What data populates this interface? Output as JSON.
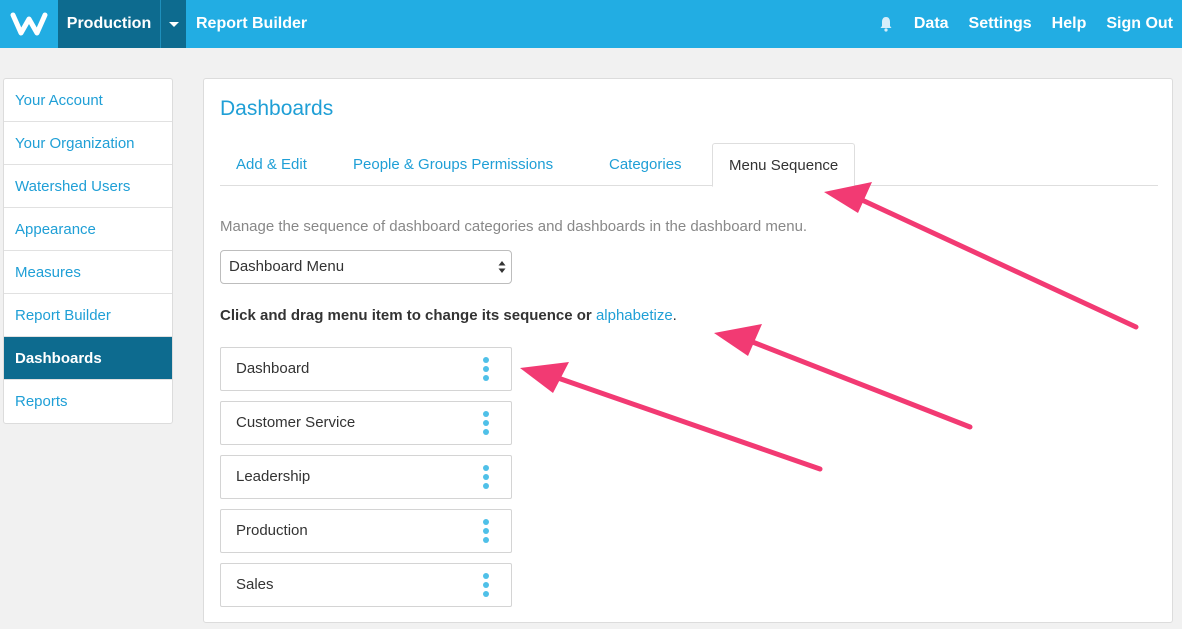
{
  "header": {
    "environment": "Production",
    "app_title": "Report Builder",
    "nav": [
      "Data",
      "Settings",
      "Help",
      "Sign Out"
    ],
    "icons": {
      "logo": "watershed-logo",
      "bell": "bell-icon",
      "caret": "chevron-down-icon"
    },
    "bg_color": "#22ade3",
    "env_color": "#0d6b8f"
  },
  "sidebar": {
    "items": [
      {
        "label": "Your Account"
      },
      {
        "label": "Your Organization"
      },
      {
        "label": "Watershed Users"
      },
      {
        "label": "Appearance"
      },
      {
        "label": "Measures"
      },
      {
        "label": "Report Builder"
      },
      {
        "label": "Dashboards",
        "active": true
      },
      {
        "label": "Reports"
      }
    ]
  },
  "main": {
    "title": "Dashboards",
    "tabs": [
      {
        "label": "Add & Edit"
      },
      {
        "label": "People & Groups Permissions"
      },
      {
        "label": "Categories"
      },
      {
        "label": "Menu Sequence",
        "active": true
      }
    ],
    "description": "Manage the sequence of dashboard categories and dashboards in the dashboard menu.",
    "select": {
      "value": "Dashboard Menu"
    },
    "instruction": {
      "text": "Click and drag menu item to change its sequence or",
      "link": "alphabetize",
      "suffix": "."
    },
    "menu_items": [
      "Dashboard",
      "Customer Service",
      "Leadership",
      "Production",
      "Sales"
    ]
  },
  "annotations": {
    "arrow_color": "#f23a73"
  }
}
